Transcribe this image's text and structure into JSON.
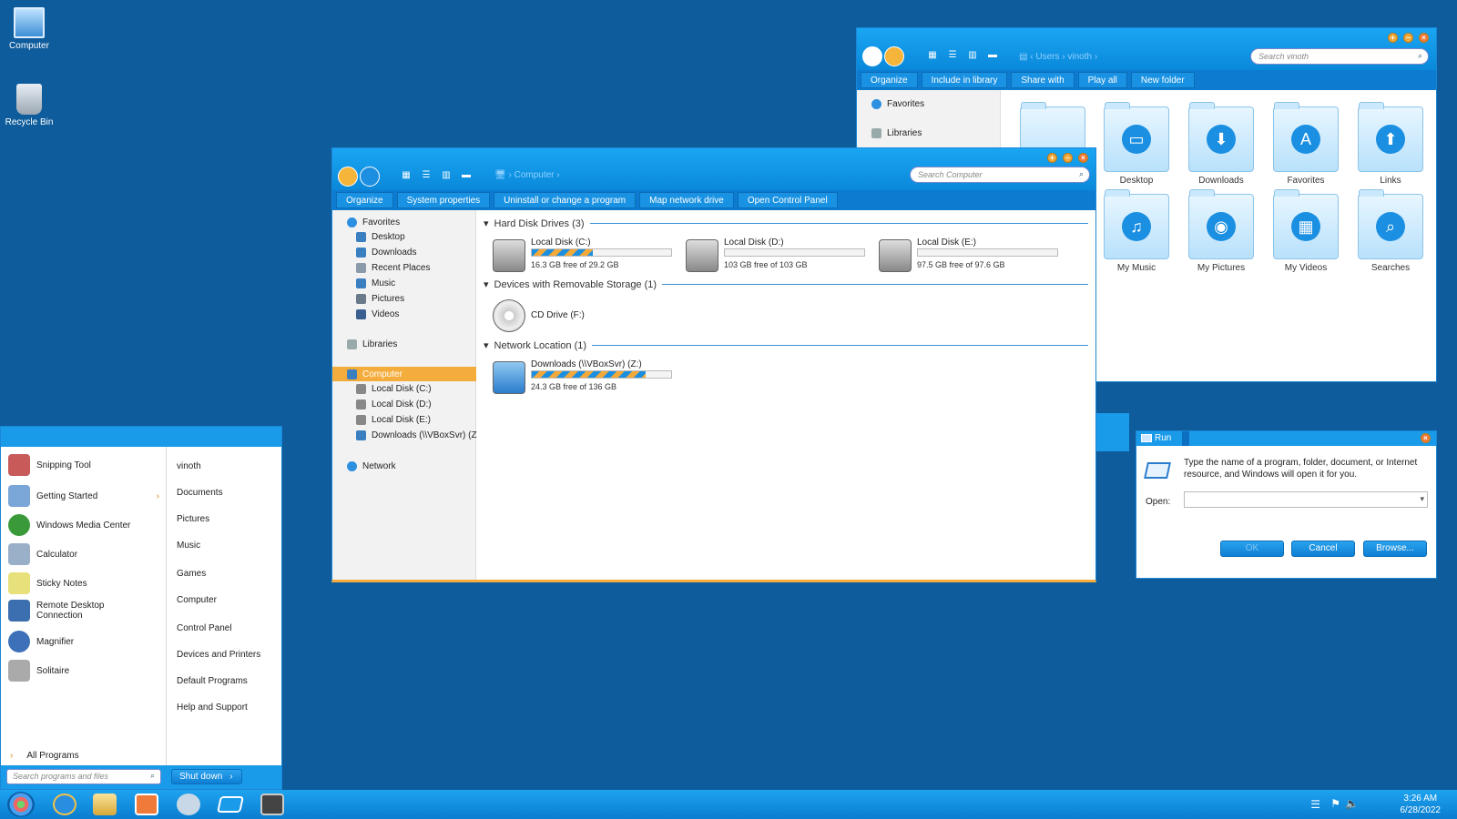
{
  "desktop": {
    "icons": [
      {
        "label": "Computer",
        "icon": "computer-icon"
      },
      {
        "label": "Recycle Bin",
        "icon": "recycle-bin-icon"
      }
    ]
  },
  "user_window": {
    "address": [
      "Users",
      "vinoth"
    ],
    "search_placeholder": "Search vinoth",
    "commands": [
      "Organize",
      "Include in library",
      "Share with",
      "Play all",
      "New folder"
    ],
    "nav": [
      "Favorites",
      "Libraries"
    ],
    "folders": [
      {
        "label": "Desktop",
        "icon": "desktop-folder-icon",
        "glyph": "▭"
      },
      {
        "label": "Downloads",
        "icon": "downloads-folder-icon",
        "glyph": "⬇"
      },
      {
        "label": "Favorites",
        "icon": "favorites-folder-icon",
        "glyph": "A"
      },
      {
        "label": "Links",
        "icon": "links-folder-icon",
        "glyph": "⬆"
      },
      {
        "label": "My Music",
        "icon": "music-folder-icon",
        "glyph": "♫"
      },
      {
        "label": "My Pictures",
        "icon": "pictures-folder-icon",
        "glyph": "◉"
      },
      {
        "label": "My Videos",
        "icon": "videos-folder-icon",
        "glyph": "▦"
      },
      {
        "label": "Searches",
        "icon": "searches-folder-icon",
        "glyph": "⌕"
      }
    ]
  },
  "computer_window": {
    "address": [
      "Computer"
    ],
    "search_placeholder": "Search Computer",
    "commands": [
      "Organize",
      "System properties",
      "Uninstall or change a program",
      "Map network drive",
      "Open Control Panel"
    ],
    "nav": {
      "favorites": "Favorites",
      "fav_items": [
        "Desktop",
        "Downloads",
        "Recent Places",
        "Music",
        "Pictures",
        "Videos"
      ],
      "libraries": "Libraries",
      "computer": "Computer",
      "computer_items": [
        "Local Disk (C:)",
        "Local Disk (D:)",
        "Local Disk (E:)",
        "Downloads (\\\\VBoxSvr) (Z"
      ],
      "network": "Network"
    },
    "groups": {
      "hdd": "Hard Disk Drives (3)",
      "removable": "Devices with Removable Storage (1)",
      "network": "Network Location (1)"
    },
    "drives": [
      {
        "name": "Local Disk (C:)",
        "free": "16.3 GB free of 29.2 GB",
        "used": 0.44
      },
      {
        "name": "Local Disk (D:)",
        "free": "103 GB free of 103 GB",
        "used": 0.0
      },
      {
        "name": "Local Disk (E:)",
        "free": "97.5 GB free of 97.6 GB",
        "used": 0.0
      }
    ],
    "cd": {
      "name": "CD Drive (F:)"
    },
    "net_drive": {
      "name": "Downloads (\\\\VBoxSvr) (Z:)",
      "free": "24.3 GB free of 136 GB",
      "used": 0.82
    }
  },
  "start_menu": {
    "programs": [
      {
        "label": "Snipping Tool",
        "color": "#c85a5a"
      },
      {
        "label": "Getting Started",
        "color": "#7aa6d8",
        "arrow": "›"
      },
      {
        "label": "Windows Media Center",
        "color": "#3a9a3a"
      },
      {
        "label": "Calculator",
        "color": "#9ab0c8"
      },
      {
        "label": "Sticky Notes",
        "color": "#e8e07a"
      },
      {
        "label": "Remote Desktop Connection",
        "color": "#3c6fb0"
      },
      {
        "label": "Magnifier",
        "color": "#3c70b8"
      },
      {
        "label": "Solitaire",
        "color": "#aaaaaa"
      }
    ],
    "all_programs": "All Programs",
    "places": [
      "vinoth",
      "Documents",
      "Pictures",
      "Music",
      "Games",
      "Computer",
      "Control Panel",
      "Devices and Printers",
      "Default Programs",
      "Help and Support"
    ],
    "search_placeholder": "Search programs and files",
    "shutdown": "Shut down"
  },
  "run_dialog": {
    "title": "Run",
    "description": "Type the name of a program, folder, document, or Internet resource, and Windows will open it for you.",
    "open_label": "Open:",
    "open_value": "",
    "ok": "OK",
    "cancel": "Cancel",
    "browse": "Browse..."
  },
  "taskbar": {
    "time": "3:26 AM",
    "date": "6/28/2022"
  },
  "colors": {
    "accent": "#1a9bea",
    "orange": "#f4ad3d",
    "desktop": "#0e5c9c"
  }
}
